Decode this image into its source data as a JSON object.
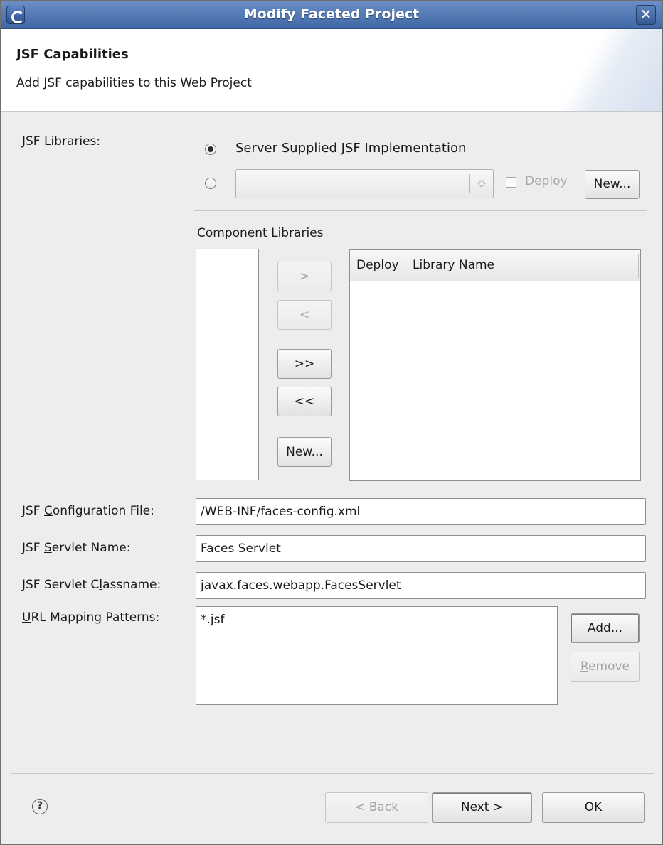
{
  "window": {
    "title": "Modify Faceted Project",
    "close_glyph": "✕",
    "icon": "eclipse-app-icon"
  },
  "header": {
    "title": "JSF Capabilities",
    "description": "Add JSF capabilities to this Web Project"
  },
  "libraries": {
    "label": "JSF Libraries:",
    "server_supplied_label": "Server Supplied JSF Implementation",
    "server_supplied_selected": true,
    "user_library_selected": false,
    "user_library_value": "",
    "combo_arrow": "◇",
    "deploy_label": "Deploy",
    "deploy_checked": false,
    "new_button": "New..."
  },
  "component_libraries": {
    "label": "Component Libraries",
    "add_button": ">",
    "remove_button": "<",
    "add_all_button": ">>",
    "remove_all_button": "<<",
    "new_button": "New...",
    "columns": [
      "Deploy",
      "Library Name"
    ],
    "available": [],
    "selected": []
  },
  "config": {
    "config_file": {
      "label_pre": "JSF ",
      "label_u": "C",
      "label_post": "onfiguration File:",
      "value": "/WEB-INF/faces-config.xml"
    },
    "servlet_name": {
      "label_pre": "JSF ",
      "label_u": "S",
      "label_post": "ervlet Name:",
      "value": "Faces Servlet"
    },
    "servlet_class": {
      "label_pre": "JSF Servlet C",
      "label_u": "l",
      "label_post": "assname:",
      "value": "javax.faces.webapp.FacesServlet"
    },
    "url_mapping": {
      "label_u": "U",
      "label_post": "RL Mapping Patterns:",
      "patterns": [
        "*.jsf"
      ],
      "add_u": "A",
      "add_post": "dd...",
      "remove_u": "R",
      "remove_post": "emove"
    }
  },
  "footer": {
    "help_glyph": "?",
    "back_pre": "< ",
    "back_u": "B",
    "back_post": "ack",
    "next_u": "N",
    "next_post": "ext >",
    "ok": "OK"
  }
}
